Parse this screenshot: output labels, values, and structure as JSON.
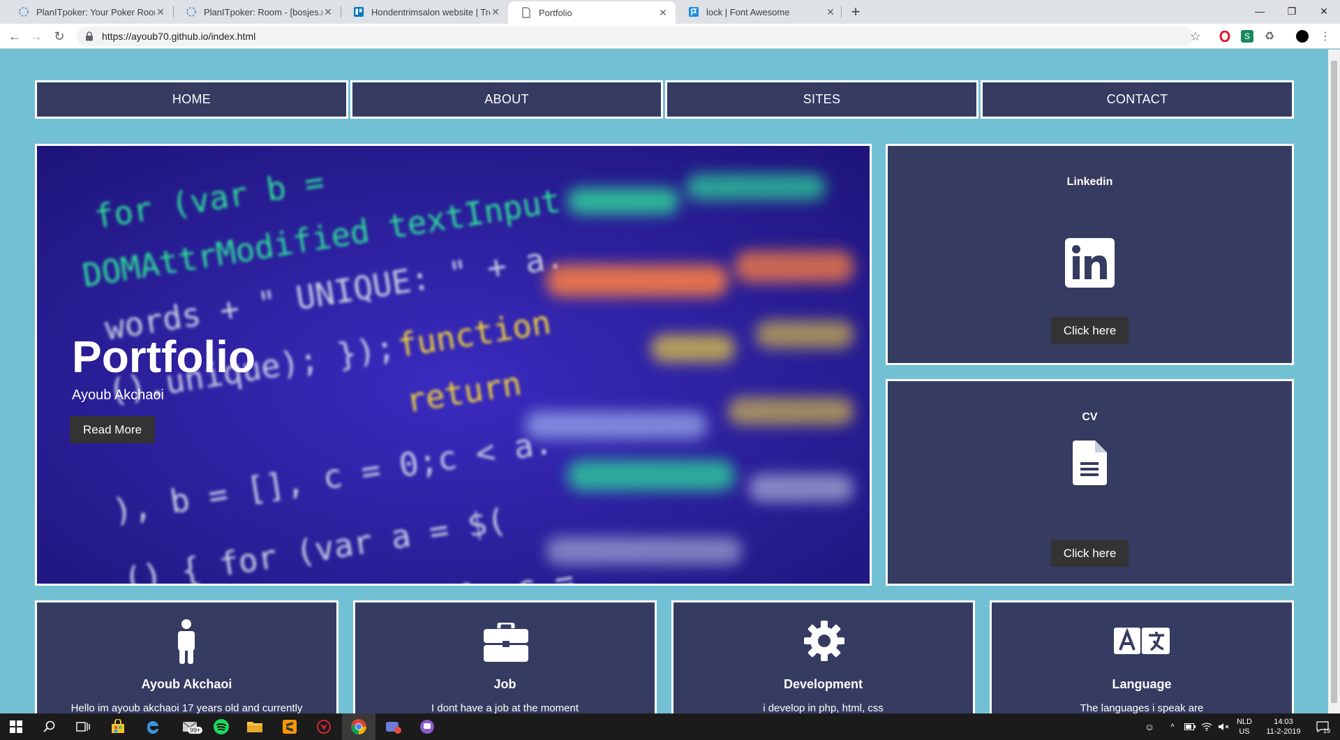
{
  "browser": {
    "tabs": [
      {
        "title": "PlanITpoker: Your Poker Rooms",
        "icon": "planitpoker-icon",
        "active": false
      },
      {
        "title": "PlanITpoker: Room - [bosjes.nl]",
        "icon": "planitpoker-icon",
        "active": false
      },
      {
        "title": "Hondentrimsalon website | Trello",
        "icon": "trello-icon",
        "active": false
      },
      {
        "title": "Portfolio",
        "icon": "page-icon",
        "active": true
      },
      {
        "title": "lock | Font Awesome",
        "icon": "font-awesome-icon",
        "active": false
      }
    ],
    "new_tab": "+",
    "url": "https://ayoub70.github.io/index.html",
    "window_controls": {
      "minimize": "—",
      "restore": "❐",
      "close": "✕"
    },
    "nav": {
      "back": "←",
      "forward": "→",
      "reload": "↻"
    }
  },
  "nav": {
    "home": "HOME",
    "about": "ABOUT",
    "sites": "SITES",
    "contact": "CONTACT"
  },
  "hero": {
    "title": "Portfolio",
    "subtitle": "Ayoub Akchaoi",
    "button": "Read More"
  },
  "side_cards": {
    "linkedin": {
      "title": "Linkedin",
      "icon": "linkedin-icon",
      "button": "Click here"
    },
    "cv": {
      "title": "CV",
      "icon": "file-icon",
      "button": "Click here"
    }
  },
  "bottom_cards": [
    {
      "title": "Ayoub Akchaoi",
      "icon": "person-icon",
      "text": "Hello im ayoub akchaoi 17 years old and currently"
    },
    {
      "title": "Job",
      "icon": "briefcase-icon",
      "text": "I dont have a job at the moment"
    },
    {
      "title": "Development",
      "icon": "gear-icon",
      "text": "i develop in php, html, css"
    },
    {
      "title": "Language",
      "icon": "language-icon",
      "text": "The languages i speak are"
    }
  ],
  "taskbar": {
    "language": "NLD",
    "region": "US",
    "time": "14:03",
    "date": "11-2-2019",
    "notifications": "19",
    "mail_badge": "99+"
  },
  "colors": {
    "page_bg": "#72c0d4",
    "card_bg": "#363b61",
    "button_bg": "#333333",
    "border": "#ffffff"
  }
}
